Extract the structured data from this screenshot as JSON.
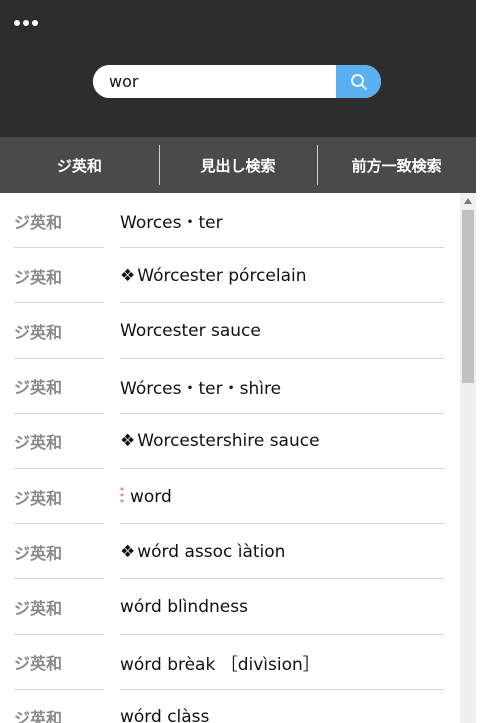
{
  "header": {
    "menu_icon": "more-horizontal-icon",
    "search": {
      "value": "wor",
      "icon": "search-icon"
    }
  },
  "tabs": [
    {
      "label": "ジ英和"
    },
    {
      "label": "見出し検索"
    },
    {
      "label": "前方一致検索"
    }
  ],
  "results": [
    {
      "source": "ジ英和",
      "prefix": "",
      "word": "Worces・ter"
    },
    {
      "source": "ジ英和",
      "prefix": "❖",
      "word": "Wórcester pórcelain"
    },
    {
      "source": "ジ英和",
      "prefix": "",
      "word": "Worcester sauce"
    },
    {
      "source": "ジ英和",
      "prefix": "",
      "word": "Wórces・ter・shìre"
    },
    {
      "source": "ジ英和",
      "prefix": "❖",
      "word": "Worcestershire sauce"
    },
    {
      "source": "ジ英和",
      "prefix": "***",
      "word": "word"
    },
    {
      "source": "ジ英和",
      "prefix": "❖",
      "word": "wórd assoc ìàtion"
    },
    {
      "source": "ジ英和",
      "prefix": "",
      "word": "wórd blìndness"
    },
    {
      "source": "ジ英和",
      "prefix": "",
      "word": "wórd brèak ［divìsion］"
    },
    {
      "source": "ジ英和",
      "prefix": "",
      "word": "wórd clàss"
    }
  ],
  "colors": {
    "header_bg": "#2d2d2d",
    "tabbar_bg": "#4a4a4a",
    "search_button": "#5ab0f0",
    "source_text": "#8a8a8a",
    "star_mark": "#d23a6a"
  }
}
